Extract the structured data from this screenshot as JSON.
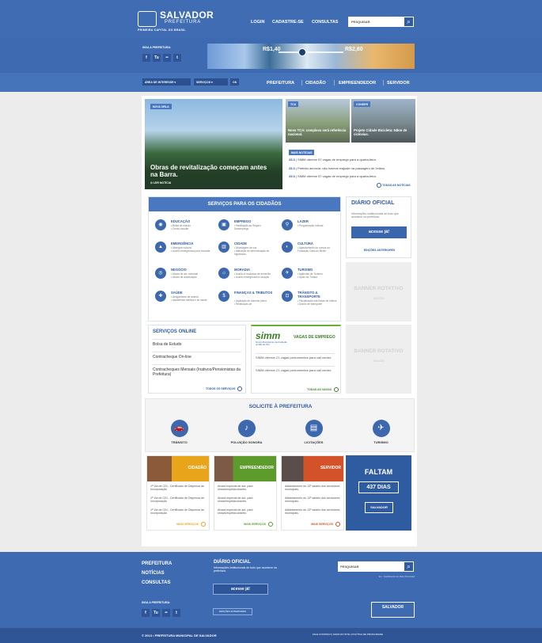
{
  "header": {
    "logo_title": "SALVADOR",
    "logo_subtitle": "PREFEITURA",
    "logo_tagline": "PRIMEIRA CAPITAL DO BRASIL",
    "nav": [
      "LOGIN",
      "CADASTRE-SE",
      "CONSULTAS"
    ],
    "search_placeholder": "PESQUISAR"
  },
  "social": {
    "label": "SIGA A PREFEITURA:",
    "icons": [
      "f",
      "Tu",
      "••",
      "t"
    ]
  },
  "banner": {
    "price_old": "R$1,40",
    "price_new": "R$2,80"
  },
  "navbar": {
    "select_area": "ÁREA DE INTERESSE",
    "select_services": "SERVIÇOS",
    "ok": "OK",
    "menu": [
      "PREFEITURA",
      "CIDADÃO",
      "EMPREENDEDOR",
      "SERVIDOR"
    ]
  },
  "featured": {
    "tag": "NOVA ORLA",
    "title": "Obras de revitalização começam antes na Barra.",
    "read_more": "LER NOTÍCIA"
  },
  "thumbs": [
    {
      "tag": "TCA",
      "caption": "Novo TCA: complexo será referência nacional."
    },
    {
      "tag": "CONDER",
      "caption": "Projeto Cidade Bicicleta: 64km de ciclovias."
    }
  ],
  "more_news": {
    "label": "MAIS NOTÍCIAS",
    "items": [
      {
        "date": "25.3",
        "text": "SIMM oferece 57 vagas de emprego para a quarta-feira."
      },
      {
        "date": "25.3",
        "text": "Prefeito anuncia: não haverá reajuste na passagem de ônibus."
      },
      {
        "date": "25.3",
        "text": "SIMM oferece 57 vagas de emprego para a quarta-feira."
      }
    ],
    "all_link": "TODAS AS NOTÍCIAS"
  },
  "services": {
    "header": "SERVIÇOS PARA OS CIDADÃOS",
    "items": [
      {
        "title": "EDUCAÇÃO",
        "desc": "• Bolsa de estudo\n• Censo escolar",
        "icon": "◉"
      },
      {
        "title": "EMPREGO",
        "desc": "• Habilitação ao Seguro-Desemprego",
        "icon": "▣"
      },
      {
        "title": "LAZER",
        "desc": "• Programação cultural",
        "icon": "⚲"
      },
      {
        "title": "EMERGÊNCIA",
        "desc": "• Albergue noturno\n• Auxílio emergencial para moradia",
        "icon": "▲"
      },
      {
        "title": "CIDADE",
        "desc": "• Abordagem de rua\n• Alteração de denominação de logradouro",
        "icon": "▥"
      },
      {
        "title": "CULTURA",
        "desc": "• Agendamento de cursos na Fundação Casa do Benin",
        "icon": "◐"
      },
      {
        "title": "NEGÓCIO",
        "desc": "• Alvará de atv. eventual\n• Alvará de autorização",
        "icon": "◎"
      },
      {
        "title": "MORADIA",
        "desc": "• Auxílio à mudança de domicílio\n• Auxílio emergencial à locação",
        "icon": "⌂"
      },
      {
        "title": "TURISMO",
        "desc": "• Agências de Turismo\n• Apoio ao Turista",
        "icon": "✈"
      },
      {
        "title": "SAÚDE",
        "desc": "• Abrigamento de animal\n• Assistência médica e de saúde",
        "icon": "✚"
      },
      {
        "title": "FINANÇAS & TRIBUTOS",
        "desc": "• Aquisição de domínio pleno\n• Restituição de",
        "icon": "$"
      },
      {
        "title": "TRÂNSITO & TRANSPORTE",
        "desc": "• Fiscalização nas linhas de ônibus\n• Auxílio de transporte",
        "icon": "⊡"
      }
    ]
  },
  "diario": {
    "title": "DIÁRIO OFICIAL",
    "desc": "Informações institucionais de tudo que acontece na prefeitura.",
    "button": "acesse já!",
    "editions": "EDIÇÕES ANTERIORES"
  },
  "banners": [
    {
      "title": "BANNER ROTATIVO",
      "size": "230X230"
    },
    {
      "title": "BANNER ROTATIVO",
      "size": "230X230"
    }
  ],
  "online": {
    "title": "SERVIÇOS ONLINE",
    "items": [
      "Bolsa de Estudo",
      "Contracheque On-line",
      "Contracheques Mensais (Inativos/Pensionistas da Prefeitura)"
    ],
    "all_link": "TODOS OS SERVIÇOS"
  },
  "simm": {
    "logo": "simm",
    "logo_sub": "Serviço Municipal de Intermediação de Mão de obra",
    "title": "VAGAS DE EMPREGO",
    "items": [
      "SIMM oferece 21 vagas permanentes para call center.",
      "SIMM oferece 21 vagas permanentes para call center."
    ],
    "all_link": "TODAS AS VAGAS"
  },
  "solicite": {
    "title": "SOLICITE À PREFEITURA",
    "items": [
      {
        "label": "TRÂNSITO",
        "icon": "🚗"
      },
      {
        "label": "POLUIÇÃO SONORA",
        "icon": "♪"
      },
      {
        "label": "LICITAÇÕES",
        "icon": "▤"
      },
      {
        "label": "TURISMO",
        "icon": "✈"
      }
    ]
  },
  "profiles": [
    {
      "label": "CIDADÃO",
      "color": "#e8a51b",
      "items": [
        "1ª Via de CDI - Certificado de Dispensa de Incorporação",
        "1ª Via de CDI - Certificado de Dispensa de Incorporação",
        "1ª Via de CDI - Certificado de Dispensa de Incorporação"
      ],
      "more": "MAIS SERVIÇOS"
    },
    {
      "label": "EMPREENDEDOR",
      "color": "#5d9c2c",
      "items": [
        "Alvará especial de aut. para shows/espetáculos/etc.",
        "Alvará especial de aut. para shows/espetáculos/etc.",
        "Alvará especial de aut. para shows/espetáculos/etc."
      ],
      "more": "MAIS SERVIÇOS"
    },
    {
      "label": "SERVIDOR",
      "color": "#d4522a",
      "items": [
        "Adiantamento do 13º salário dos servidores municipais.",
        "Adiantamento do 13º salário dos servidores municipais.",
        "Adiantamento do 13º salário dos servidores municipais."
      ],
      "more": "MAIS SERVIÇOS"
    }
  ],
  "faltam": {
    "title": "FALTAM",
    "days": "437 DIAS",
    "logo": "SALVADOR"
  },
  "footer": {
    "links": [
      "PREFEITURA",
      "NOTÍCIAS",
      "CONSULTAS"
    ],
    "diario_title": "DIÁRIO OFICIAL",
    "diario_desc": "Informações institucionais de tudo que acontece na prefeitura.",
    "diario_button": "acesse já!",
    "editions": "EDIÇÕES ANTERIORES",
    "social_label": "SIGA A PREFEITURA:",
    "search_placeholder": "PESQUISAR",
    "search_example": "Ex.: Habilitação de Mãe Municipal",
    "logo": "SALVADOR",
    "copyright": "© 2013 • PREFEITURA MUNICIPAL DE SALVADOR",
    "bottom_links": "FALE CONOSCO | MAPA DO SITE | POLÍTICA DE PRIVACIDADE"
  }
}
